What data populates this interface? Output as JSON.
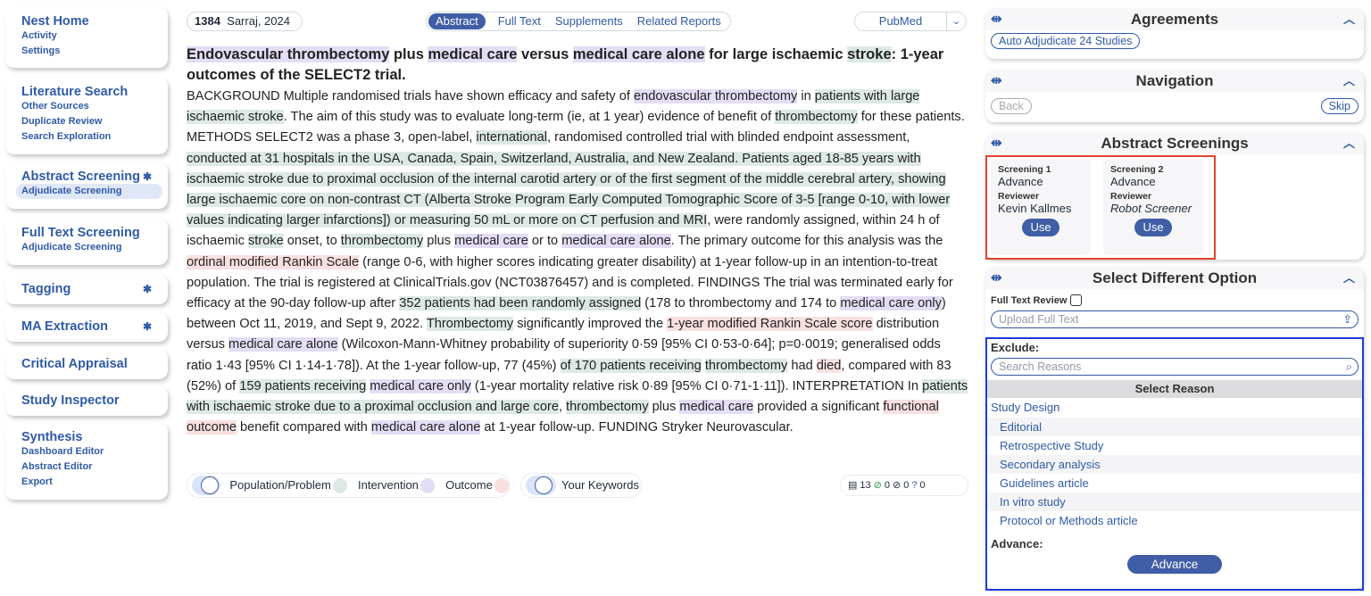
{
  "sidebar": {
    "nest_home": "Nest Home",
    "activity": "Activity",
    "settings": "Settings",
    "lit_search": "Literature Search",
    "other_sources": "Other Sources",
    "duplicate_review": "Duplicate Review",
    "search_exploration": "Search Exploration",
    "abstract_screening": "Abstract Screening",
    "adjudicate_screening": "Adjudicate Screening",
    "full_text_screening": "Full Text Screening",
    "ft_adjudicate": "Adjudicate Screening",
    "tagging": "Tagging",
    "ma_extraction": "MA Extraction",
    "critical_appraisal": "Critical Appraisal",
    "study_inspector": "Study Inspector",
    "synthesis": "Synthesis",
    "dashboard_editor": "Dashboard Editor",
    "abstract_editor": "Abstract Editor",
    "export": "Export"
  },
  "study": {
    "id": "1384",
    "citation": "Sarraj, 2024"
  },
  "tabs": [
    "Abstract",
    "Full Text",
    "Supplements",
    "Related Reports"
  ],
  "pubmed": "PubMed",
  "title": [
    {
      "t": "Endovascular thrombectomy",
      "h": "i"
    },
    {
      "t": " plus "
    },
    {
      "t": "medical care",
      "h": "i"
    },
    {
      "t": " versus "
    },
    {
      "t": "medical care alone",
      "h": "i"
    },
    {
      "t": " for large ischaemic "
    },
    {
      "t": "stroke",
      "h": "p"
    },
    {
      "t": ": 1-year outcomes of the SELECT2 trial."
    }
  ],
  "abstract": [
    {
      "t": "BACKGROUND Multiple randomised trials have shown efficacy and safety of "
    },
    {
      "t": "endovascular thrombectomy",
      "h": "i"
    },
    {
      "t": " in "
    },
    {
      "t": "patients with large ischaemic stroke",
      "h": "p"
    },
    {
      "t": ". The aim of this study was to evaluate long-term (ie, at 1 year) evidence of benefit of "
    },
    {
      "t": "thrombectomy",
      "h": "p"
    },
    {
      "t": " for these patients. METHODS SELECT2 was a phase 3, open-label, "
    },
    {
      "t": "international",
      "h": "p"
    },
    {
      "t": ", randomised controlled trial with blinded endpoint assessment, "
    },
    {
      "t": "conducted at 31 hospitals in the USA, Canada, Spain, Switzerland, Australia, and New Zealand. Patients aged 18-85 years with ischaemic stroke due to proximal occlusion of the internal carotid artery or of the first segment of the middle cerebral artery, showing large ischaemic core on non-contrast CT (Alberta Stroke Program Early Computed Tomographic Score of 3-5 [range 0-10, with lower values indicating larger infarctions]) or measuring 50 mL or more on CT perfusion and MRI",
      "h": "p"
    },
    {
      "t": ", were randomly assigned, within 24 h of ischaemic "
    },
    {
      "t": "stroke",
      "h": "p"
    },
    {
      "t": " onset, to "
    },
    {
      "t": "thrombectomy",
      "h": "p"
    },
    {
      "t": " plus "
    },
    {
      "t": "medical care",
      "h": "i"
    },
    {
      "t": " or to "
    },
    {
      "t": "medical care alone",
      "h": "i"
    },
    {
      "t": ". The primary outcome for this analysis was the "
    },
    {
      "t": "ordinal modified Rankin Scale",
      "h": "o"
    },
    {
      "t": " (range 0-6, with higher scores indicating greater disability) at 1-year follow-up in an intention-to-treat population. The trial is registered at ClinicalTrials.gov (NCT03876457) and is completed. FINDINGS The trial was terminated early for efficacy at the 90-day follow-up after "
    },
    {
      "t": "352 patients had been randomly assigned",
      "h": "p"
    },
    {
      "t": " (178 to thrombectomy and 174 to "
    },
    {
      "t": "medical care only",
      "h": "i"
    },
    {
      "t": ") between Oct 11, 2019, and Sept 9, 2022. "
    },
    {
      "t": "Thrombectomy",
      "h": "p"
    },
    {
      "t": " significantly improved the "
    },
    {
      "t": "1-year modified Rankin Scale score",
      "h": "o"
    },
    {
      "t": " distribution versus "
    },
    {
      "t": "medical care alone",
      "h": "i"
    },
    {
      "t": " (Wilcoxon-Mann-Whitney probability of superiority 0·59 [95% CI 0·53-0·64]; p=0·0019; generalised odds ratio 1·43 [95% CI 1·14-1·78]). At the 1-year follow-up, 77 (45%) "
    },
    {
      "t": "of 170 patients receiving",
      "h": "p"
    },
    {
      "t": " "
    },
    {
      "t": "thrombectomy",
      "h": "p"
    },
    {
      "t": " had "
    },
    {
      "t": "died",
      "h": "o"
    },
    {
      "t": ", compared with 83 (52%) of "
    },
    {
      "t": "159 patients receiving",
      "h": "p"
    },
    {
      "t": " "
    },
    {
      "t": "medical care only",
      "h": "i"
    },
    {
      "t": " (1-year mortality relative risk 0·89 [95% CI 0·71-1·11]). INTERPRETATION In "
    },
    {
      "t": "patients with ischaemic stroke due to a proximal occlusion and large core",
      "h": "p"
    },
    {
      "t": ", "
    },
    {
      "t": "thrombectomy",
      "h": "p"
    },
    {
      "t": " plus "
    },
    {
      "t": "medical care",
      "h": "i"
    },
    {
      "t": " provided a significant "
    },
    {
      "t": "functional outcome",
      "h": "o"
    },
    {
      "t": " benefit compared with "
    },
    {
      "t": "medical care alone",
      "h": "i"
    },
    {
      "t": " at 1-year follow-up. FUNDING Stryker Neurovascular."
    }
  ],
  "legend": {
    "population": "Population/Problem",
    "intervention": "Intervention",
    "outcome": "Outcome",
    "keywords": "Your Keywords",
    "c_notes": "13",
    "c_ok": "0",
    "c_block": "0",
    "c_q": "0"
  },
  "agreements": {
    "title": "Agreements",
    "button": "Auto Adjudicate 24 Studies"
  },
  "navigation": {
    "title": "Navigation",
    "back": "Back",
    "skip": "Skip"
  },
  "screenings": {
    "title": "Abstract Screenings",
    "items": [
      {
        "label": "Screening 1",
        "decision": "Advance",
        "reviewer_label": "Reviewer",
        "reviewer": "Kevin Kallmes",
        "use": "Use"
      },
      {
        "label": "Screening 2",
        "decision": "Advance",
        "reviewer_label": "Reviewer",
        "reviewer": "Robot Screener",
        "use": "Use"
      }
    ]
  },
  "options": {
    "title": "Select Different Option",
    "full_text_review": "Full Text Review",
    "upload_placeholder": "Upload Full Text",
    "exclude": "Exclude:",
    "search_placeholder": "Search Reasons",
    "select_reason": "Select Reason",
    "category": "Study Design",
    "reasons": [
      "Editorial",
      "Retrospective Study",
      "Secondary analysis",
      "Guidelines article",
      "In vitro study",
      "Protocol or Methods article"
    ],
    "advance_label": "Advance:",
    "advance_button": "Advance"
  },
  "colors": {
    "accent": "#2f5aa7",
    "population": "#dde9e4",
    "intervention": "#e4ddf6",
    "outcome": "#f9e0e0",
    "red_box": "#e0442c",
    "blue_box": "#1f3cd6"
  }
}
